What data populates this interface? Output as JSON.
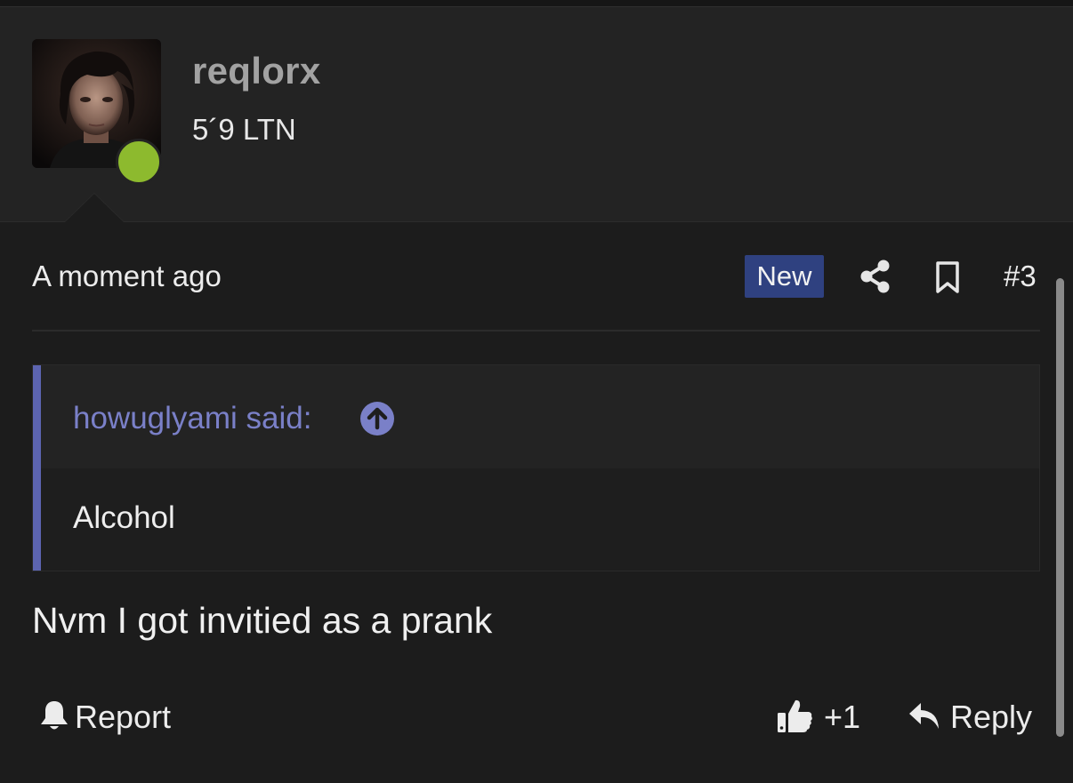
{
  "user": {
    "username": "reqlorx",
    "title": "5´9 LTN",
    "online": true,
    "avatar_icon": "user-photo"
  },
  "post": {
    "time": "A moment ago",
    "new_badge": "New",
    "share_icon": "share-icon",
    "bookmark_icon": "bookmark-icon",
    "number": "#3",
    "quote": {
      "author": "howuglyami said:",
      "jump_icon": "arrow-up-circle-icon",
      "content": "Alcohol"
    },
    "message": "Nvm I got invitied as a prank"
  },
  "actions": {
    "report_label": "Report",
    "report_icon": "bell-icon",
    "like_icon": "thumbs-up-icon",
    "like_count": "+1",
    "reply_label": "Reply",
    "reply_icon": "reply-arrow-icon"
  },
  "colors": {
    "background": "#1c1c1c",
    "header_background": "#232323",
    "online_green": "#8dba2e",
    "badge_blue": "#2f4180",
    "quote_accent": "#5c64b0",
    "quote_author": "#7a80c8"
  }
}
